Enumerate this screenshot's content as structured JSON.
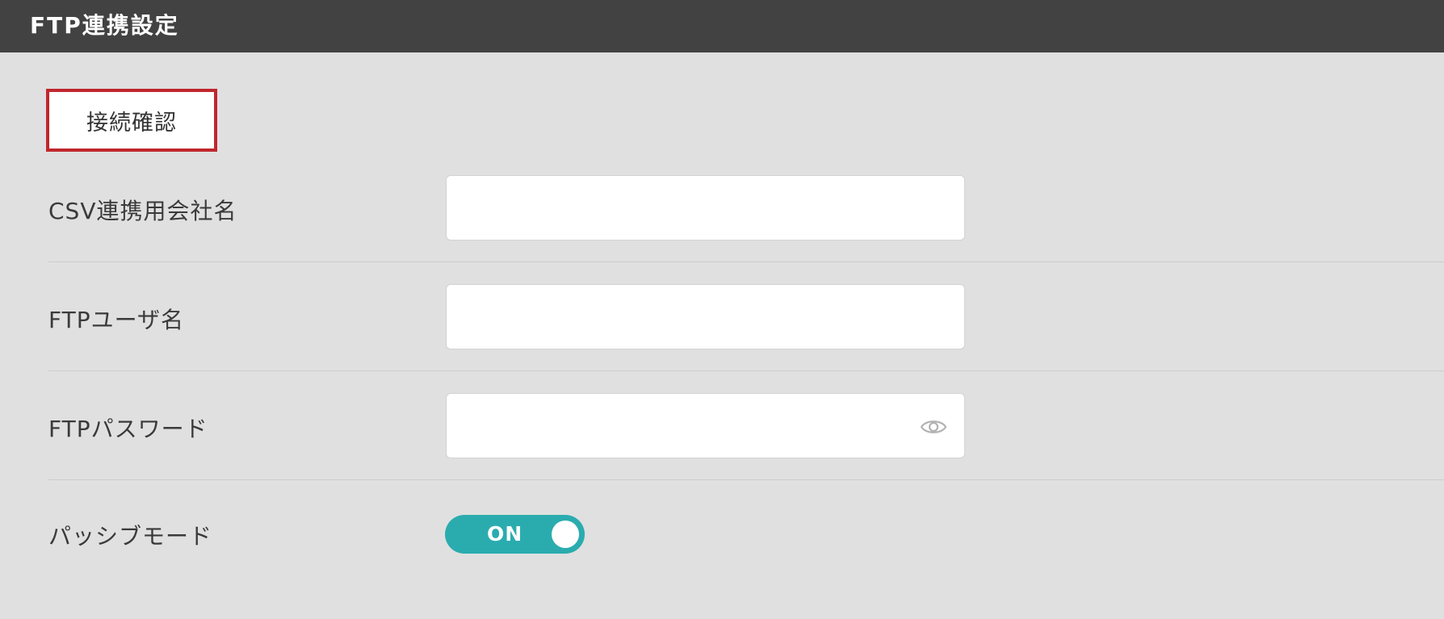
{
  "header": {
    "title": "FTP連携設定"
  },
  "actions": {
    "connection_check_label": "接続確認"
  },
  "form": {
    "company_name": {
      "label": "CSV連携用会社名",
      "value": "",
      "placeholder": ""
    },
    "ftp_username": {
      "label": "FTPユーザ名",
      "value": "",
      "placeholder": ""
    },
    "ftp_password": {
      "label": "FTPパスワード",
      "value": "",
      "placeholder": "",
      "icon": "eye-icon"
    },
    "passive_mode": {
      "label": "パッシブモード",
      "state_label": "ON",
      "enabled": true
    }
  },
  "colors": {
    "header_bg": "#424242",
    "page_bg": "#e0e0e0",
    "highlight_border": "#c0272d",
    "toggle_on": "#2aacaf"
  }
}
